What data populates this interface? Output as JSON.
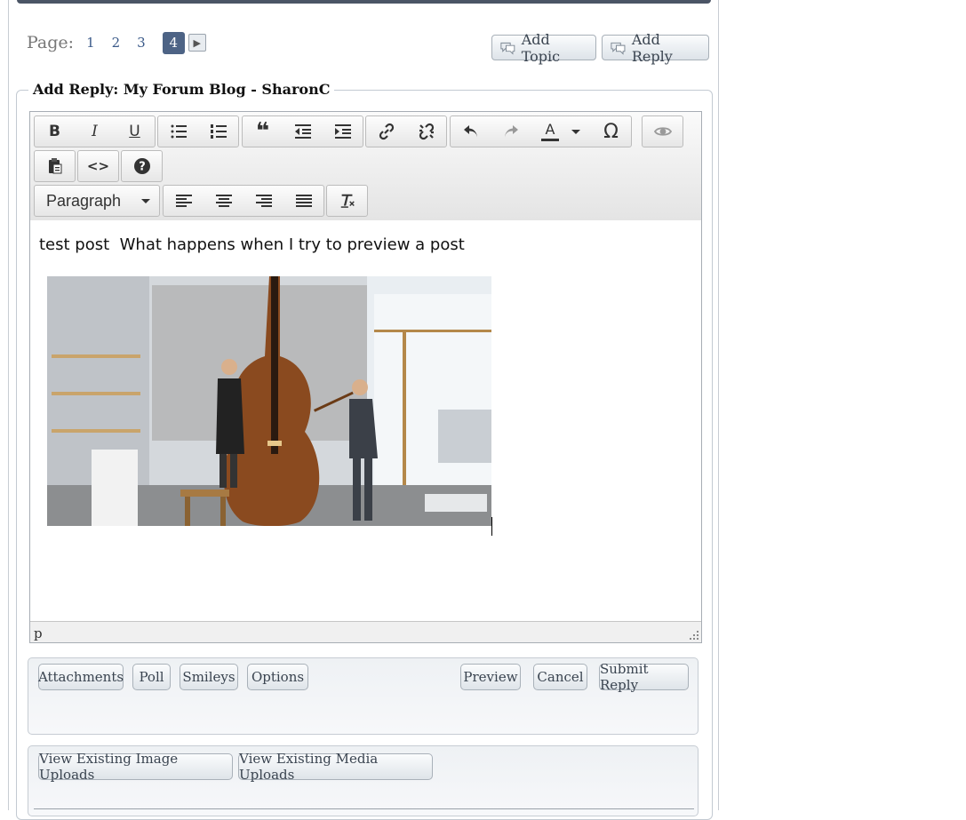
{
  "pager": {
    "label": "Page:",
    "pages": [
      "1",
      "2",
      "3"
    ],
    "current": "4"
  },
  "actions": {
    "add_topic": "Add Topic",
    "add_reply": "Add Reply"
  },
  "form": {
    "legend": "Add Reply: My Forum Blog - SharonC"
  },
  "toolbar": {
    "format_select": "Paragraph"
  },
  "editor": {
    "text": "test post  What happens when I try to preview a post",
    "status_path": "p"
  },
  "bottom_panel": {
    "attachments": "Attachments",
    "poll": "Poll",
    "smileys": "Smileys",
    "options": "Options",
    "preview": "Preview",
    "cancel": "Cancel",
    "submit": "Submit Reply"
  },
  "uploads_panel": {
    "view_images": "View Existing Image Uploads",
    "view_media": "View Existing Media Uploads"
  },
  "icons": [
    "bold-icon",
    "italic-icon",
    "underline-icon",
    "bullet-list-icon",
    "numbered-list-icon",
    "blockquote-icon",
    "outdent-icon",
    "indent-icon",
    "link-icon",
    "unlink-icon",
    "undo-icon",
    "redo-icon",
    "text-color-icon",
    "special-char-icon",
    "preview-eye-icon",
    "paste-icon",
    "code-icon",
    "help-icon",
    "align-left-icon",
    "align-center-icon",
    "align-right-icon",
    "justify-icon",
    "clear-format-icon"
  ],
  "colors": {
    "accent": "#4d6385",
    "link": "#3b5a89",
    "topbar": "#4b5566"
  }
}
